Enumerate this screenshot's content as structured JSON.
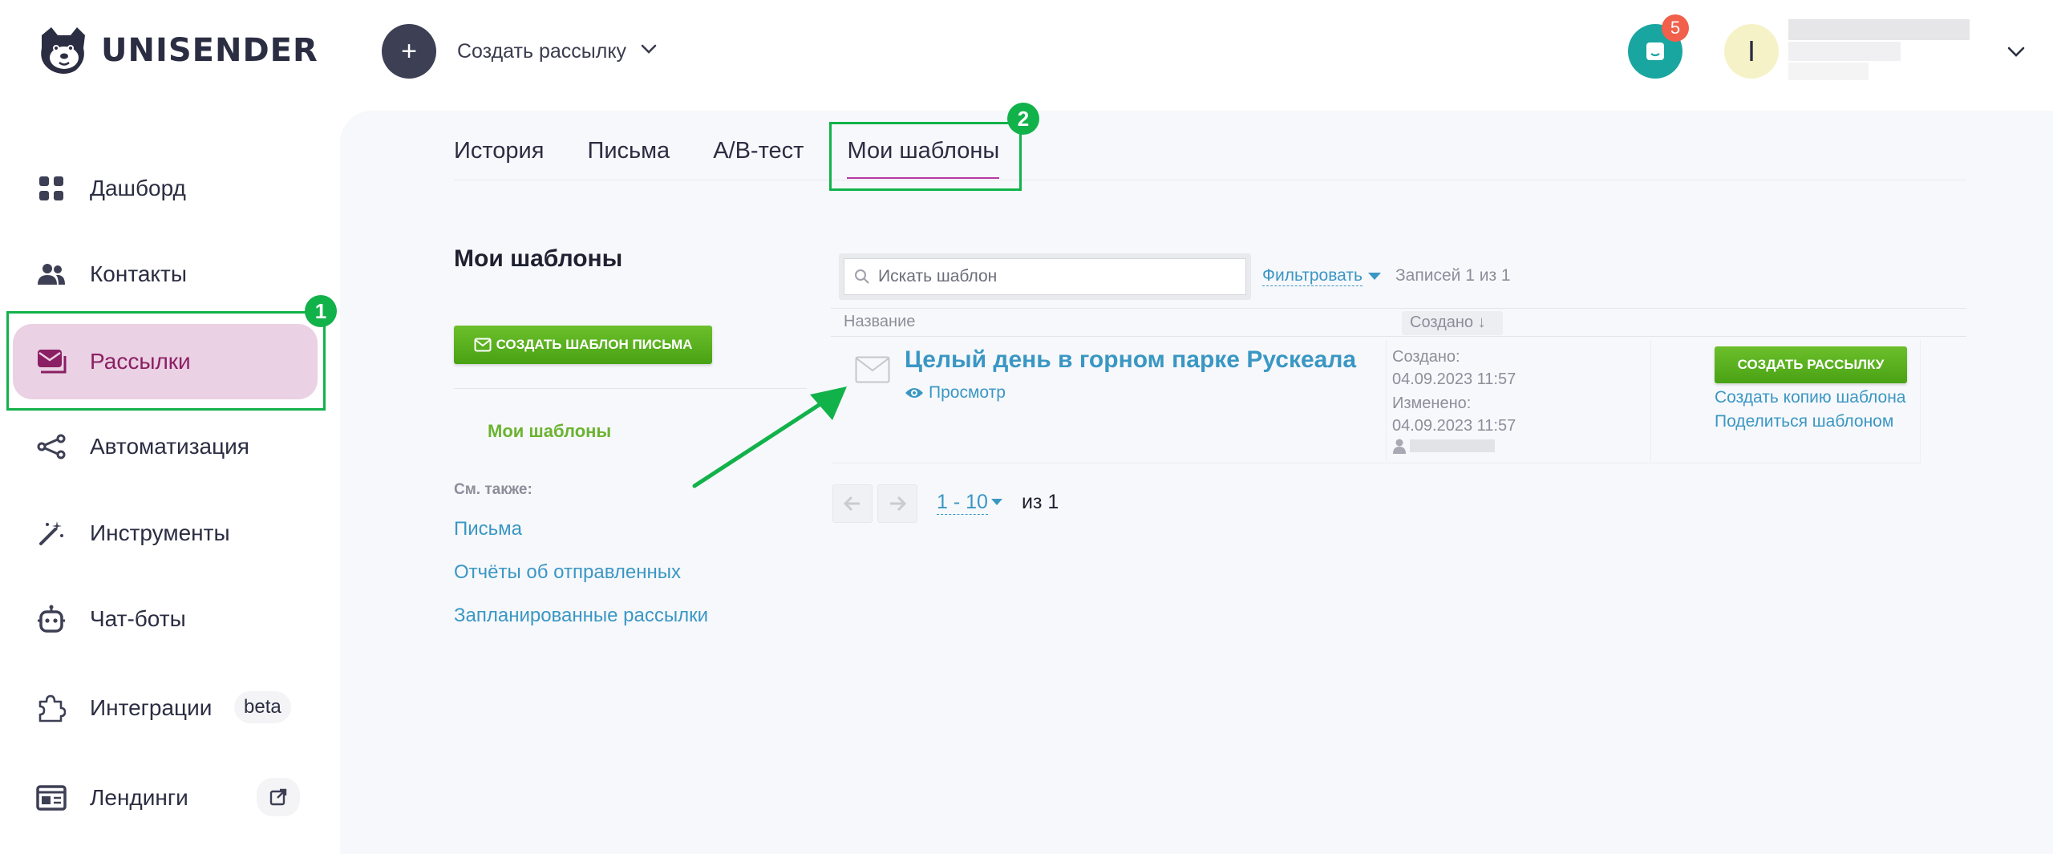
{
  "brand": {
    "name": "UNISENDER"
  },
  "header": {
    "create_label": "Создать рассылку",
    "create_plus": "+",
    "notifications_count": "5",
    "avatar_initial": "I"
  },
  "sidebar": {
    "items": [
      {
        "label": "Дашборд",
        "icon": "dashboard-icon"
      },
      {
        "label": "Контакты",
        "icon": "contacts-icon"
      },
      {
        "label": "Рассылки",
        "icon": "mailings-icon",
        "active": true
      },
      {
        "label": "Автоматизация",
        "icon": "automation-icon"
      },
      {
        "label": "Инструменты",
        "icon": "magic-wand-icon"
      },
      {
        "label": "Чат-боты",
        "icon": "robot-icon"
      },
      {
        "label": "Интеграции",
        "icon": "puzzle-icon",
        "badge": "beta"
      },
      {
        "label": "Лендинги",
        "icon": "landing-icon",
        "external": true
      }
    ]
  },
  "tabs": [
    {
      "label": "История"
    },
    {
      "label": "Письма"
    },
    {
      "label": "A/B-тест"
    },
    {
      "label": "Мои шаблоны",
      "active": true
    }
  ],
  "left_panel": {
    "title": "Мои шаблоны",
    "create_button": "СОЗДАТЬ ШАБЛОН ПИСЬМА",
    "my_templates_link": "Мои шаблоны",
    "see_also_label": "См. также:",
    "see_also_links": [
      "Письма",
      "Отчёты об отправленных",
      "Запланированные рассылки"
    ]
  },
  "toolbar": {
    "search_placeholder": "Искать шаблон",
    "filter_label": "Фильтровать",
    "records_text": "Записей 1 из 1"
  },
  "table": {
    "headers": {
      "name": "Название",
      "created": "Создано ↓"
    },
    "rows": [
      {
        "name": "Целый день в горном парке Рускеала",
        "preview_label": "Просмотр",
        "created_label": "Создано:",
        "created_value": "04.09.2023 11:57",
        "modified_label": "Изменено:",
        "modified_value": "04.09.2023 11:57",
        "action_button": "СОЗДАТЬ РАССЫЛКУ",
        "copy_link": "Создать копию шаблона",
        "share_link": "Поделиться шаблоном"
      }
    ]
  },
  "pagination": {
    "range": "1 - 10",
    "of_text": "из 1"
  },
  "annotations": [
    {
      "number": "1",
      "target": "Рассылки"
    },
    {
      "number": "2",
      "target": "Мои шаблоны"
    }
  ],
  "colors": {
    "accent_green": "#12b24a",
    "button_green": "#49a214",
    "link_blue": "#3a97c4",
    "active_nav_bg": "#ead1e4",
    "active_nav_text": "#8b1f63",
    "chat_teal": "#1aa6a0",
    "badge_red": "#f0604b"
  }
}
